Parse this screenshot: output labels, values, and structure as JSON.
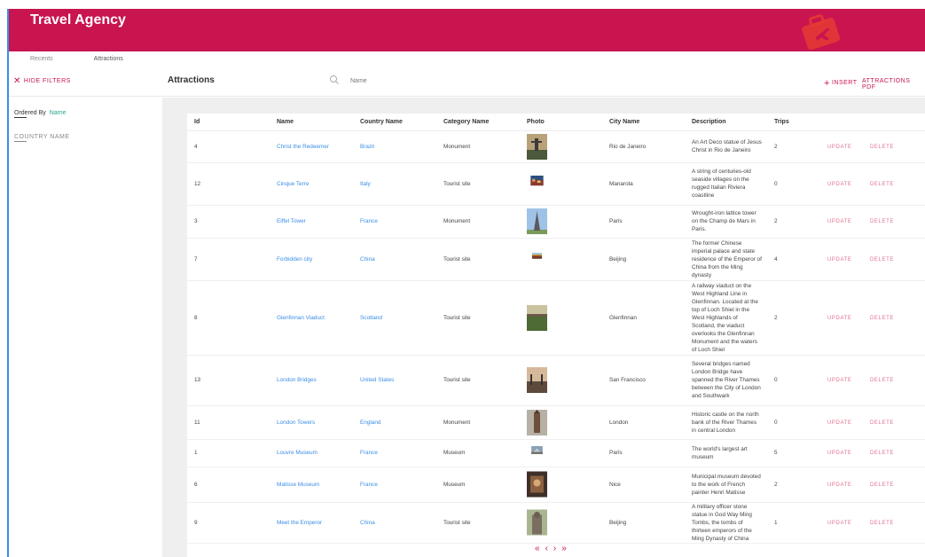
{
  "app": {
    "title": "Travel Agency"
  },
  "tabs": [
    {
      "label": "Recents"
    },
    {
      "label": "Attractions"
    }
  ],
  "filters": {
    "hide_label": "HIDE FILTERS",
    "ordered_by_label": "Ordered By",
    "ordered_by_value": "Name",
    "country_filter_label": "COUNTRY NAME"
  },
  "toolbar": {
    "title": "Attractions",
    "search_placeholder": "Name",
    "insert_label": "INSERT",
    "pdf_label": "ATTRACTIONS PDF"
  },
  "table": {
    "columns": [
      "Id",
      "Name",
      "Country Name",
      "Category Name",
      "Photo",
      "City Name",
      "Description",
      "Trips"
    ],
    "update_label": "UPDATE",
    "delete_label": "DELETE",
    "rows": [
      {
        "id": "4",
        "name": "Christ the Redeemer",
        "country": "Brazil",
        "category": "Monument",
        "city": "Rio de Janeiro",
        "description": "An Art Deco statue of Jesus Christ in Rio de Janeiro",
        "trips": "2",
        "photo_icon": "statue-photo"
      },
      {
        "id": "12",
        "name": "Cinque Terre",
        "country": "Italy",
        "category": "Tourist site",
        "city": "Manarola",
        "description": "A string of centuries-old seaside villages on the rugged Italian Riviera coastline",
        "trips": "0",
        "photo_icon": "village-photo"
      },
      {
        "id": "3",
        "name": "Eiffel Tower",
        "country": "France",
        "category": "Monument",
        "city": "Paris",
        "description": "Wrought-iron lattice tower on the Champ de Mars in Paris.",
        "trips": "2",
        "photo_icon": "tower-photo"
      },
      {
        "id": "7",
        "name": "Forbidden city",
        "country": "China",
        "category": "Tourist site",
        "city": "Beijing",
        "description": "The former Chinese imperial palace and state residence of the Emperor of China from the Ming dynasty",
        "trips": "4",
        "photo_icon": "palace-photo"
      },
      {
        "id": "8",
        "name": "Glenfinnan Viaduct",
        "country": "Scotland",
        "category": "Tourist site",
        "city": "Glenfinnan",
        "description": "A railway viaduct on the West Highland Line in Glenfinnan. Located at the top of Loch Shiel in the West Highlands of Scotland, the viaduct overlooks the Glenfinnan Monument and the waters of Loch Shiel",
        "trips": "2",
        "photo_icon": "viaduct-photo"
      },
      {
        "id": "13",
        "name": "London Bridges",
        "country": "United States",
        "category": "Tourist site",
        "city": "San Francisco",
        "description": "Several bridges named London Bridge have spanned the River Thames between the City of London and Southwark",
        "trips": "0",
        "photo_icon": "bridge-photo"
      },
      {
        "id": "11",
        "name": "London Towers",
        "country": "England",
        "category": "Monument",
        "city": "London",
        "description": "Historic castle on the north bank of the River Thames in central London",
        "trips": "0",
        "photo_icon": "castle-photo"
      },
      {
        "id": "1",
        "name": "Louvre Museum",
        "country": "France",
        "category": "Museum",
        "city": "Paris",
        "description": "The world's largest art museum",
        "trips": "5",
        "photo_icon": "museum-photo"
      },
      {
        "id": "6",
        "name": "Matisse Museum",
        "country": "France",
        "category": "Museum",
        "city": "Nice",
        "description": "Municipal museum devoted to the work of French painter Henri Matisse",
        "trips": "2",
        "photo_icon": "painting-photo"
      },
      {
        "id": "9",
        "name": "Meet the Emperor",
        "country": "China",
        "category": "Tourist site",
        "city": "Beijing",
        "description": "A military officer stone statue in God Way Ming Tombs, the tombs of thirteen emperors of the Ming Dynasty of China",
        "trips": "1",
        "photo_icon": "stone-statue-photo"
      }
    ]
  },
  "pager": {
    "first": "«",
    "prev": "‹",
    "next": "›",
    "last": "»"
  },
  "colors": {
    "brand": "#c8144f",
    "link": "#3a8ee6",
    "accent": "#2ca58d"
  }
}
